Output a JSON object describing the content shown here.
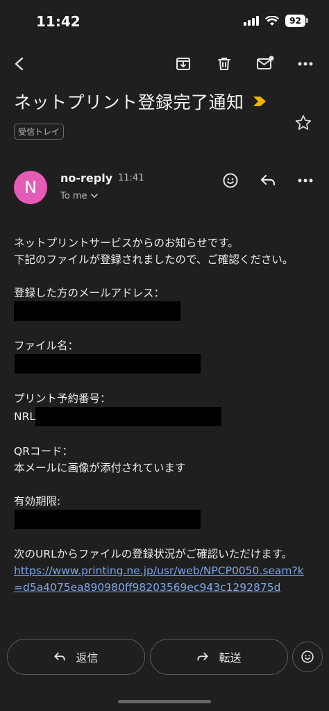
{
  "status": {
    "time": "11:42",
    "battery": "92"
  },
  "email": {
    "subject": "ネットプリント登録完了通知",
    "label": "受信トレイ",
    "sender": {
      "name": "no-reply",
      "time": "11:41",
      "avatar_letter": "N",
      "to": "To me"
    },
    "body": {
      "intro": [
        "ネットプリントサービスからのお知らせです。",
        "下記のファイルが登録されましたので、ご確認ください。"
      ],
      "email_label": "登録した方のメールアドレス：",
      "file_label": "ファイル名：",
      "reserve_label": "プリント予約番号：",
      "reserve_prefix": "NRL",
      "qr_label": "QRコード：",
      "qr_text": "本メールに画像が添付されています",
      "expiry_label": "有効期限:",
      "url_intro": "次のURLからファイルの登録状況がご確認いただけます。",
      "url": "https://www.printing.ne.jp/usr/web/NPCP0050.seam?k=d5a4075ea890980ff98203569ec943c1292875d"
    }
  },
  "actions": {
    "reply": "返信",
    "forward": "転送"
  },
  "colors": {
    "background": "#1f1f1f",
    "avatar": "#e55cb5",
    "link": "#7ea6ea",
    "importance": "#f4b400"
  }
}
